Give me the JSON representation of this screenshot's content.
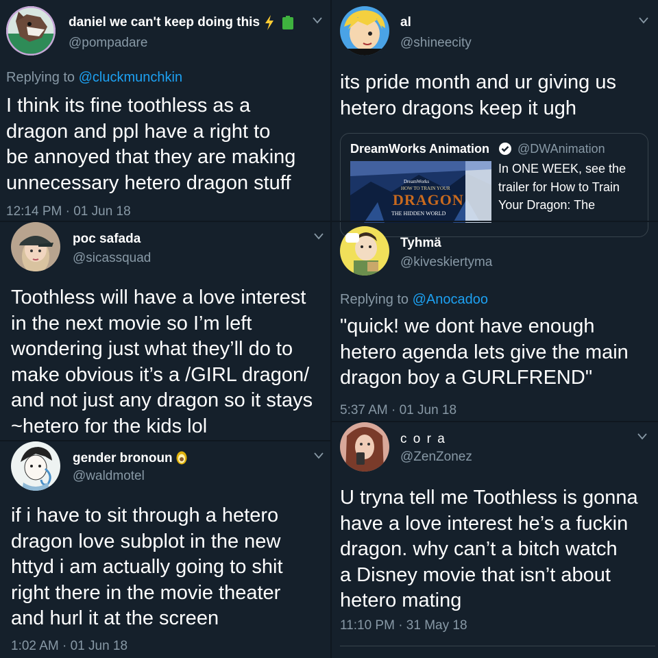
{
  "accent": "#1da1f2",
  "tweets": [
    {
      "name": "daniel we can't keep doing this",
      "name_icons": [
        "lightning-icon",
        "battery-icon"
      ],
      "handle": "@pompadare",
      "reply_prefix": "Replying to ",
      "reply_to": "@cluckmunchkin",
      "text": "I think its fine toothless as a\ndragon and ppl have a right to\nbe annoyed that they are making\nunnecessary hetero dragon stuff",
      "timestamp": "12:14 PM · 01 Jun 18"
    },
    {
      "name": "al",
      "handle": "@shineecity",
      "text": "its pride month and ur giving us\nhetero dragons keep it ugh",
      "quote": {
        "name": "DreamWorks Animation",
        "handle": "@DWAnimation",
        "text": "In ONE WEEK, see the\ntrailer for How to Train\nYour Dragon: The",
        "image_logo": "DreamWorks",
        "image_subtitle": "HOW TO TRAIN YOUR",
        "image_title": "DRAGON",
        "image_tagline": "THE HIDDEN WORLD"
      }
    },
    {
      "name": "poc safada",
      "handle": "@sicassquad",
      "text": "Toothless will have a love interest\nin the next movie so I’m left\nwondering just what they’ll do to\nmake obvious it’s a /GIRL dragon/\nand not just any dragon so it stays\n~hetero for the kids lol"
    },
    {
      "name": "Tyhmä",
      "handle": "@kiveskiertyma",
      "reply_prefix": "Replying to ",
      "reply_to": "@Anocadoo",
      "text": "\"quick! we dont have enough\nhetero agenda lets give the main\ndragon boy a GURLFREND\"",
      "timestamp": "5:37 AM · 01 Jun 18"
    },
    {
      "name": "gender bronoun",
      "name_icons": [
        "avocado-icon"
      ],
      "handle": "@waldmotel",
      "text": "if i have to sit through a hetero\ndragon love subplot in the new\nhttyd i am actually going to shit\nright there in the movie theater\nand hurl it at the screen",
      "timestamp": "1:02 AM · 01 Jun 18"
    },
    {
      "name": "c o r a",
      "handle": "@ZenZonez",
      "text": "U tryna tell me Toothless is gonna\nhave a love interest he’s a fuckin\ndragon. why can’t a bitch watch\na Disney movie that isn’t about\nhetero mating",
      "timestamp": "11:10 PM · 31 May 18"
    }
  ]
}
